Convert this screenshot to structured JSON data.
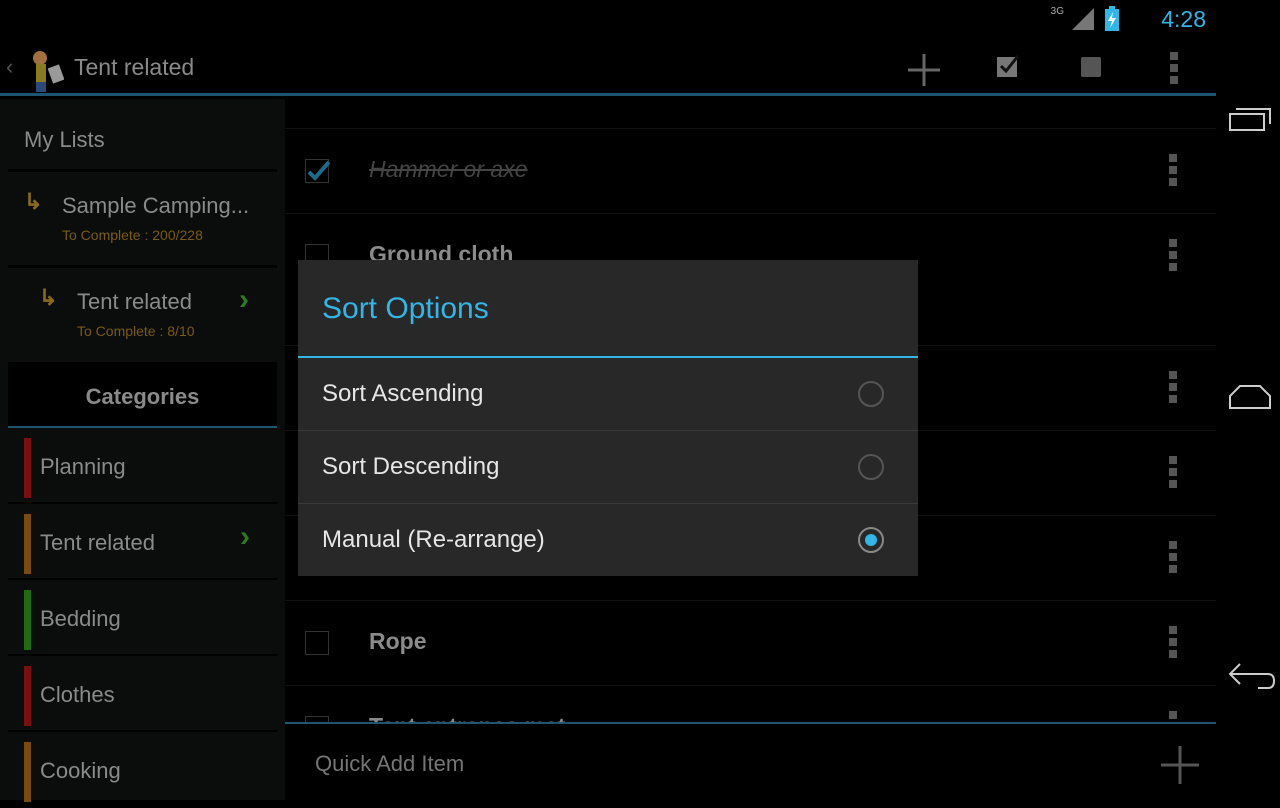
{
  "status": {
    "network": "3G",
    "time": "4:28"
  },
  "actionbar": {
    "title": "Tent related"
  },
  "sidebar": {
    "my_lists": "My Lists",
    "lists": [
      {
        "name": "Sample Camping...",
        "sub": "To Complete : 200/228"
      },
      {
        "name": "Tent related",
        "sub": "To Complete : 8/10",
        "selected": true
      }
    ],
    "categories_header": "Categories",
    "categories": [
      {
        "label": "Planning",
        "color": "#7a0f0f"
      },
      {
        "label": "Tent related",
        "color": "#7a4a0f",
        "selected": true
      },
      {
        "label": "Bedding",
        "color": "#1f6a12"
      },
      {
        "label": "Clothes",
        "color": "#7a0f0f"
      },
      {
        "label": "Cooking",
        "color": "#7a4a0f"
      }
    ]
  },
  "items": [
    {
      "name": "Hammer or axe",
      "checked": true
    },
    {
      "name": "Ground cloth",
      "checked": false
    },
    {
      "name": "",
      "checked": false
    },
    {
      "name": "",
      "checked": false
    },
    {
      "name": "",
      "checked": false
    },
    {
      "name": "Rope",
      "checked": false
    },
    {
      "name": "Tent entrance mat",
      "checked": false
    }
  ],
  "quick_add": {
    "placeholder": "Quick Add Item"
  },
  "dialog": {
    "title": "Sort Options",
    "options": [
      {
        "label": "Sort Ascending",
        "selected": false
      },
      {
        "label": "Sort Descending",
        "selected": false
      },
      {
        "label": "Manual (Re-arrange)",
        "selected": true
      }
    ]
  },
  "colors": {
    "accent": "#33b5e5"
  }
}
